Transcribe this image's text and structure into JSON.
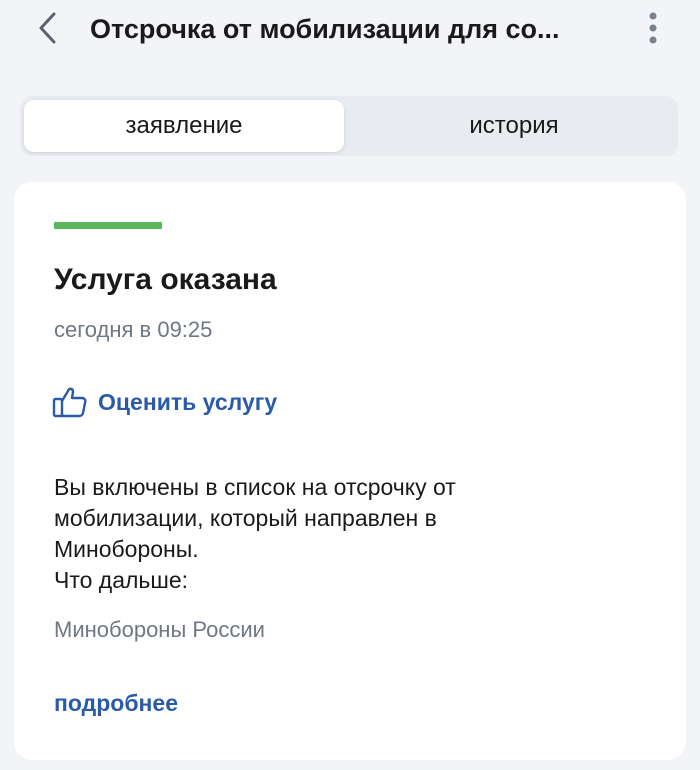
{
  "header": {
    "title": "Отсрочка от мобилизации для со...",
    "back_icon": "chevron-left-icon",
    "more_icon": "more-vertical-icon"
  },
  "tabs": [
    {
      "label": "заявление",
      "active": true
    },
    {
      "label": "история",
      "active": false
    }
  ],
  "status": {
    "color": "#5cb85c",
    "title": "Услуга оказана",
    "date": "сегодня в 09:25"
  },
  "rate": {
    "icon": "thumbs-up-icon",
    "label": "Оценить услугу"
  },
  "message": {
    "lines": [
      "Вы включены в список на отсрочку от",
      "мобилизации, который направлен в",
      "Минобороны.",
      "Что дальше:"
    ],
    "organization": "Минобороны России"
  },
  "details_link": "подробнее",
  "colors": {
    "accent": "#2a5ba8",
    "success": "#5cb85c",
    "muted": "#6f7782",
    "background": "#f2f4f7"
  }
}
